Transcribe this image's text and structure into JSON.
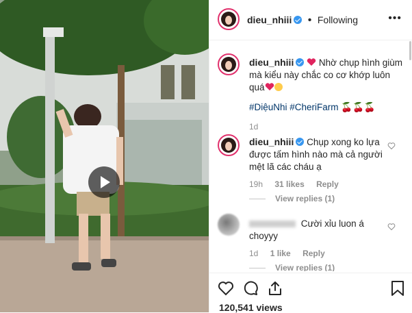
{
  "header": {
    "username": "dieu_nhiii",
    "separator": "•",
    "follow_status": "Following",
    "more_icon": "more-horizontal-icon"
  },
  "caption": {
    "username": "dieu_nhiii",
    "text": "Nhờ chụp hình giùm mà kiểu này chắc co cơ khớp luôn quá",
    "hashtags": "#DiệuNhi #CheriFarm",
    "time": "1d"
  },
  "comments": [
    {
      "username": "dieu_nhiii",
      "text": "Chụp xong ko lựa được tấm hình nào mà cả người mệt lã các cháu ạ",
      "time": "19h",
      "likes": "31 likes",
      "reply_label": "Reply",
      "view_replies": "View replies (1)"
    },
    {
      "username": "",
      "text": "Cười xỉu luon á choyyy",
      "time": "1d",
      "likes": "1 like",
      "reply_label": "Reply",
      "view_replies": "View replies (1)"
    }
  ],
  "stats": {
    "views": "120,541 views"
  },
  "colors": {
    "verified": "#3897f0",
    "heart": "#ed4956",
    "hashtag": "#003569",
    "muted": "#8e8e8e"
  }
}
